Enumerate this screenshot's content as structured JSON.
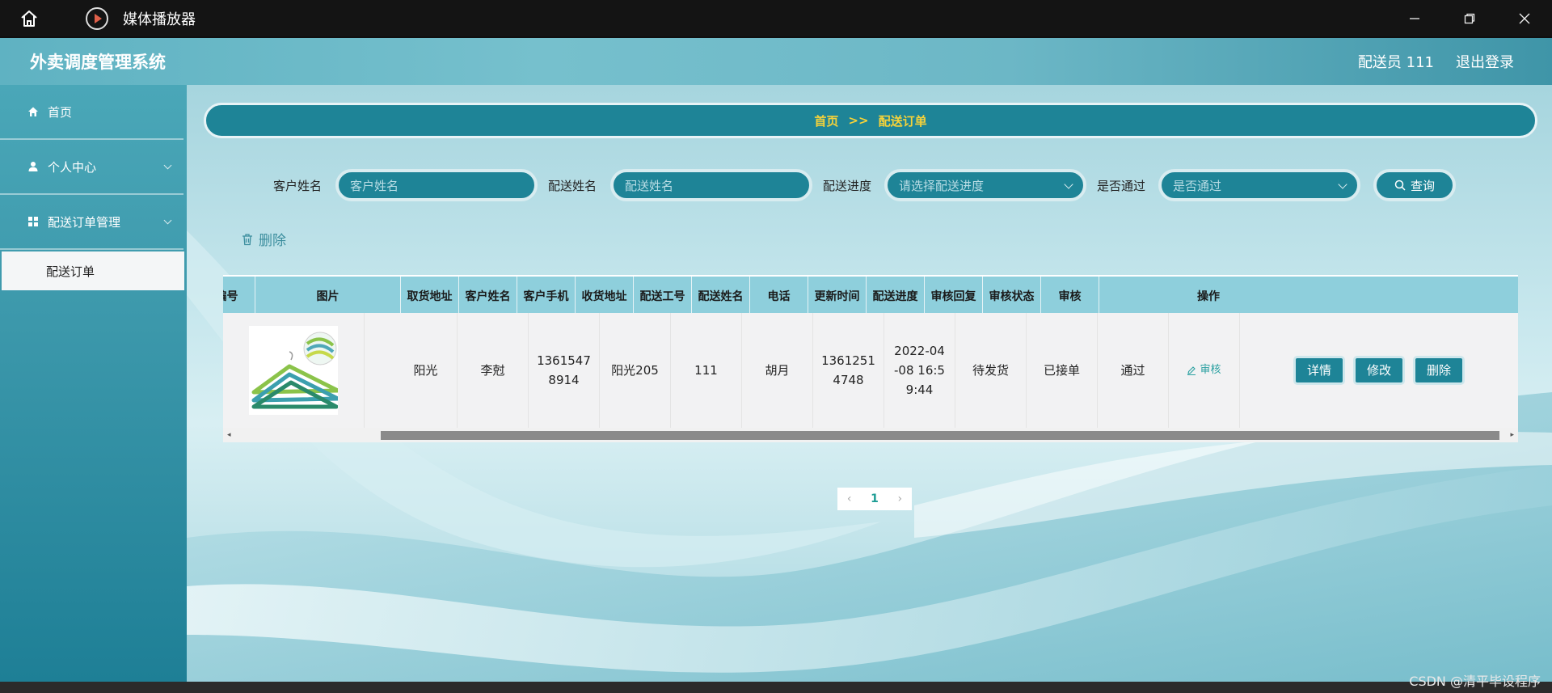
{
  "window": {
    "title": "媒体播放器",
    "controls": [
      "minimize",
      "restore",
      "close"
    ]
  },
  "app": {
    "brand": "外卖调度管理系统",
    "user": "配送员 111",
    "logout": "退出登录"
  },
  "sidebar": {
    "items": [
      {
        "label": "首页",
        "icon": "home-icon"
      },
      {
        "label": "个人中心",
        "icon": "user-icon"
      },
      {
        "label": "配送订单管理",
        "icon": "grid-icon"
      }
    ],
    "sub_item": "配送订单"
  },
  "breadcrumb": {
    "home": "首页",
    "sep": ">>",
    "current": "配送订单"
  },
  "search": {
    "customer_label": "客户姓名",
    "customer_placeholder": "客户姓名",
    "courier_label": "配送姓名",
    "courier_placeholder": "配送姓名",
    "progress_label": "配送进度",
    "progress_placeholder": "请选择配送进度",
    "pass_label": "是否通过",
    "pass_placeholder": "是否通过",
    "query_button": "查询"
  },
  "toolbar": {
    "delete_label": "删除"
  },
  "table": {
    "headers": [
      "编号",
      "图片",
      "取货地址",
      "客户姓名",
      "客户手机",
      "收货地址",
      "配送工号",
      "配送姓名",
      "电话",
      "更新时间",
      "配送进度",
      "审核回复",
      "审核状态",
      "审核",
      "操作"
    ],
    "row": {
      "pickup_address": "阳光",
      "customer_name": "李尅",
      "customer_phone_1": "1361547",
      "customer_phone_2": "8914",
      "delivery_address": "阳光205",
      "courier_id": "111",
      "courier_name": "胡月",
      "phone_1": "1361251",
      "phone_2": "4748",
      "update_1": "2022-04",
      "update_2": "-08 16:5",
      "update_3": "9:44",
      "progress": "待发货",
      "audit_reply": "已接单",
      "audit_status": "通过",
      "audit_action": "审核",
      "op_detail": "详情",
      "op_edit": "修改",
      "op_delete": "删除"
    }
  },
  "pagination": {
    "current": "1"
  },
  "watermark": "CSDN @清平毕设程序"
}
